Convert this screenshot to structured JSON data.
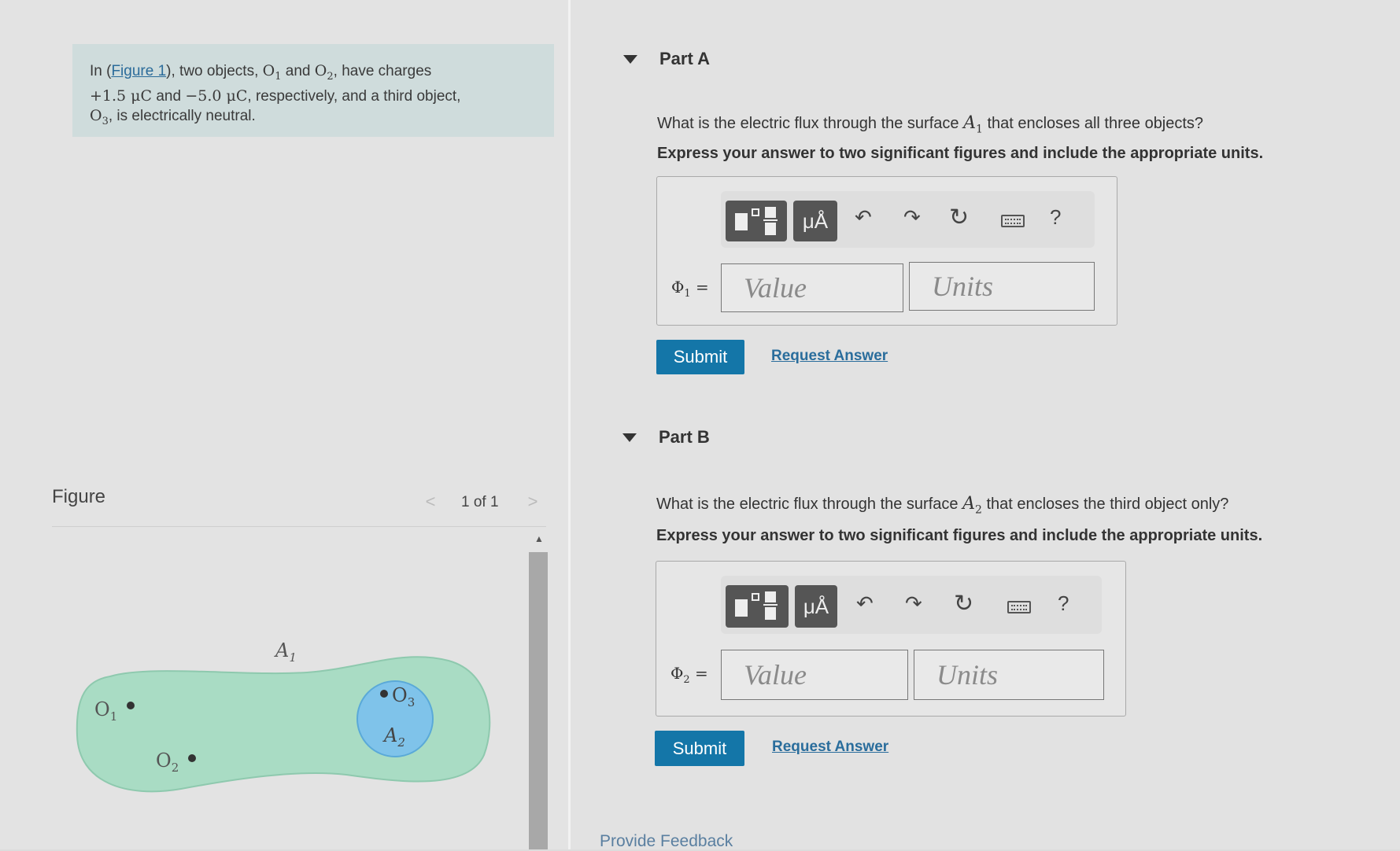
{
  "problem": {
    "text_1": "In (",
    "figure_link": "Figure 1",
    "text_2": "), two objects, ",
    "o1": "O",
    "o1_sub": "1",
    "text_3": " and ",
    "o2": "O",
    "o2_sub": "2",
    "text_4": ", have charges",
    "charge1": "+1.5 μC",
    "text_5": " and ",
    "charge2": "−5.0 μC",
    "text_6": ", respectively, and a third object,",
    "o3": "O",
    "o3_sub": "3",
    "text_7": ", is electrically neutral."
  },
  "figure_panel": {
    "header": "Figure",
    "pager_prev": "<",
    "pager_label": "1 of 1",
    "pager_next": ">",
    "labels": {
      "a1": "A",
      "a1_sub": "1",
      "a2": "A",
      "a2_sub": "2",
      "o1": "O",
      "o1_sub": "1",
      "o2": "O",
      "o2_sub": "2",
      "o3": "O",
      "o3_sub": "3"
    },
    "colors": {
      "outer_surface": "#a9dcc4",
      "inner_surface": "#7fc3ea"
    }
  },
  "part_a": {
    "header": "Part A",
    "question_pre": "What is the electric flux through the surface ",
    "surface": "A",
    "surface_sub": "1",
    "question_post": " that encloses all three objects?",
    "instruction": "Express your answer to two significant figures and include the appropriate units.",
    "eq_symbol": "Φ",
    "eq_sub": "1",
    "eq_sign": " =",
    "value_placeholder": "Value",
    "units_placeholder": "Units",
    "submit_label": "Submit",
    "request_label": "Request Answer"
  },
  "part_b": {
    "header": "Part B",
    "question_pre": "What is the electric flux through the surface ",
    "surface": "A",
    "surface_sub": "2",
    "question_post": " that encloses the third object only?",
    "instruction": "Express your answer to two significant figures and include the appropriate units.",
    "eq_symbol": "Φ",
    "eq_sub": "2",
    "eq_sign": " =",
    "value_placeholder": "Value",
    "units_placeholder": "Units",
    "submit_label": "Submit",
    "request_label": "Request Answer"
  },
  "toolbar": {
    "template_icon": "fraction-template-icon",
    "units_label": "μÅ",
    "undo_icon": "undo-icon",
    "redo_icon": "redo-icon",
    "reset_icon": "reset-icon",
    "keyboard_icon": "keyboard-icon",
    "help_label": "?"
  },
  "footer": {
    "feedback": "Provide Feedback"
  },
  "colors": {
    "accent": "#1476a8",
    "link": "#2a6d9c"
  }
}
